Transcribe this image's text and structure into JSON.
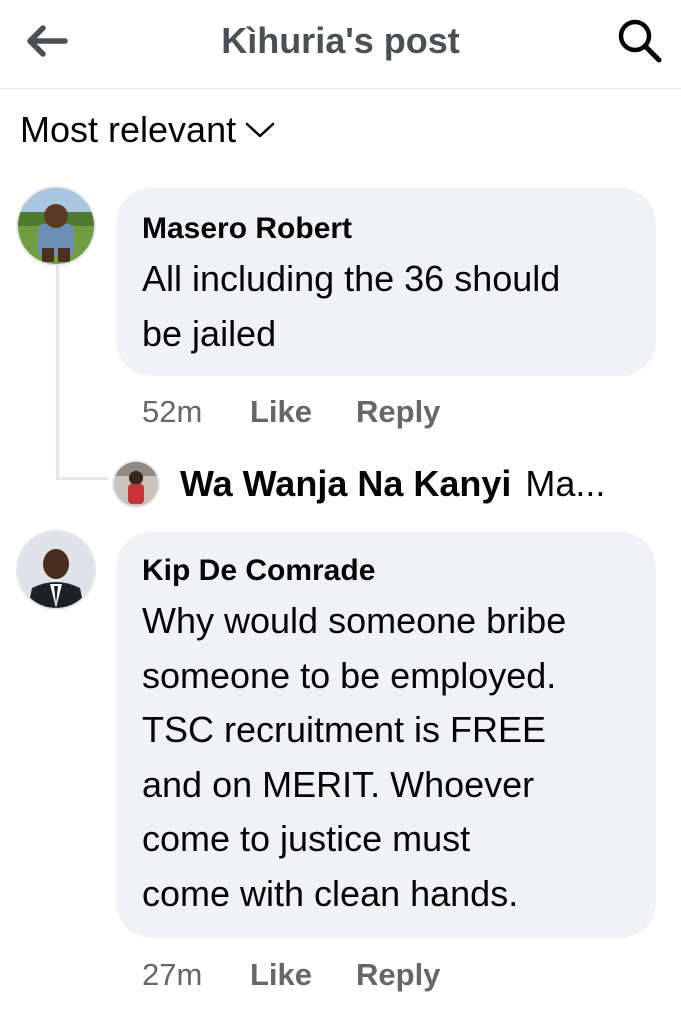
{
  "header": {
    "title": "Kìhuria's post",
    "back_icon": "arrow-left-icon",
    "search_icon": "search-icon"
  },
  "sort": {
    "label": "Most relevant",
    "icon": "chevron-down-icon"
  },
  "comments": [
    {
      "author": "Masero Robert",
      "lines": [
        "All including the 36 should",
        "be jailed"
      ],
      "time": "52m",
      "like_label": "Like",
      "reply_label": "Reply",
      "reply_preview": {
        "author": "Wa Wanja Na Kanyi",
        "preview": "Ma..."
      }
    },
    {
      "author": "Kip De Comrade",
      "lines": [
        "Why would someone bribe",
        "someone to be employed.",
        "TSC recruitment is FREE",
        "and on MERIT. Whoever",
        "come to justice must",
        "come with clean hands."
      ],
      "time": "27m",
      "like_label": "Like",
      "reply_label": "Reply"
    }
  ],
  "colors": {
    "bubble": "#f0f2f5",
    "meta": "#65676b",
    "title": "#4b4f56",
    "text": "#050505"
  }
}
